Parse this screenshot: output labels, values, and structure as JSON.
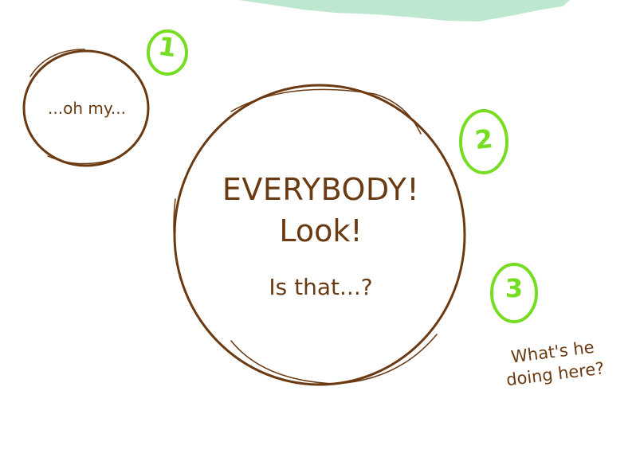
{
  "bubbles": {
    "small": {
      "text": "...oh my..."
    },
    "main": {
      "line1": "EVERYBODY!",
      "line2": "Look!",
      "line3": "Is that...?"
    },
    "side": {
      "text": "What's he doing here?"
    }
  },
  "markers": [
    "1",
    "2",
    "3"
  ],
  "colors": {
    "bubble_outline": "#6b3a12",
    "text": "#6a3a12",
    "marker": "#77dd22",
    "top_shape": "#bde8cf"
  }
}
